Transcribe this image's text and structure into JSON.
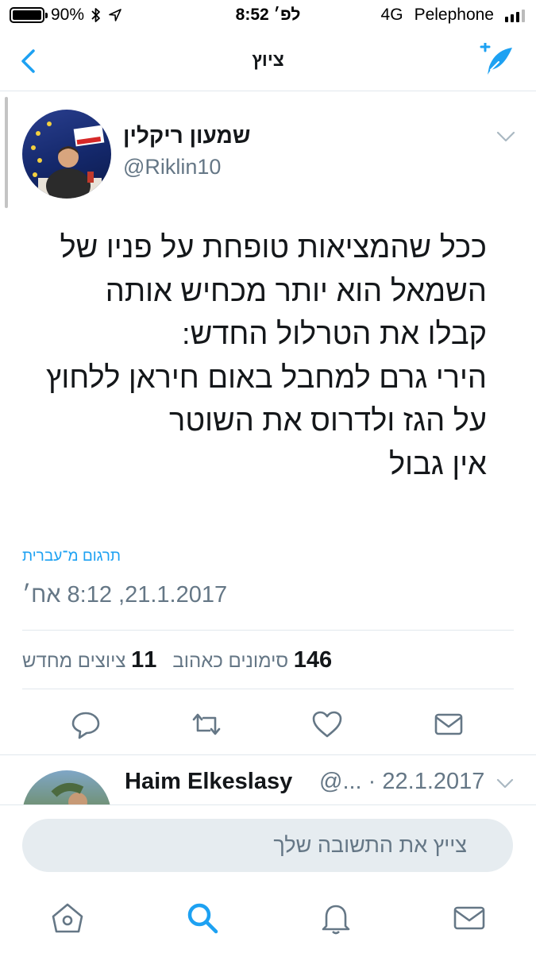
{
  "status_bar": {
    "battery": "90%",
    "time": "8:52 לפ׳",
    "network": "4G",
    "carrier": "Pelephone"
  },
  "nav": {
    "title": "ציוץ"
  },
  "tweet": {
    "author_name": "שמעון ריקלין",
    "author_handle": "@Riklin10",
    "lines": [
      "ככל שהמציאות טופחת על פניו של",
      "השמאל הוא יותר מכחיש אותה",
      "קבלו את הטרלול החדש:",
      "הירי גרם למחבל באום חיראן ללחוץ",
      "על הגז ולדרוס את השוטר",
      "אין גבול"
    ],
    "translate_label": "תרגום מ־עברית",
    "timestamp": "21.1.2017, 8:12 אח׳",
    "likes_count": "146",
    "likes_label": "סימונים כאהוב",
    "retweets_count": "11",
    "retweets_label": "ציוצים מחדש"
  },
  "reply": {
    "name": "Haim Elkeslasy",
    "meta": "@... · 22.1.2017"
  },
  "composer": {
    "placeholder": "צייץ את התשובה שלך"
  },
  "colors": {
    "accent": "#1da1f2",
    "secondary_text": "#657786",
    "divider": "#e1e8ed",
    "composer_bg": "#e6ecf0"
  }
}
